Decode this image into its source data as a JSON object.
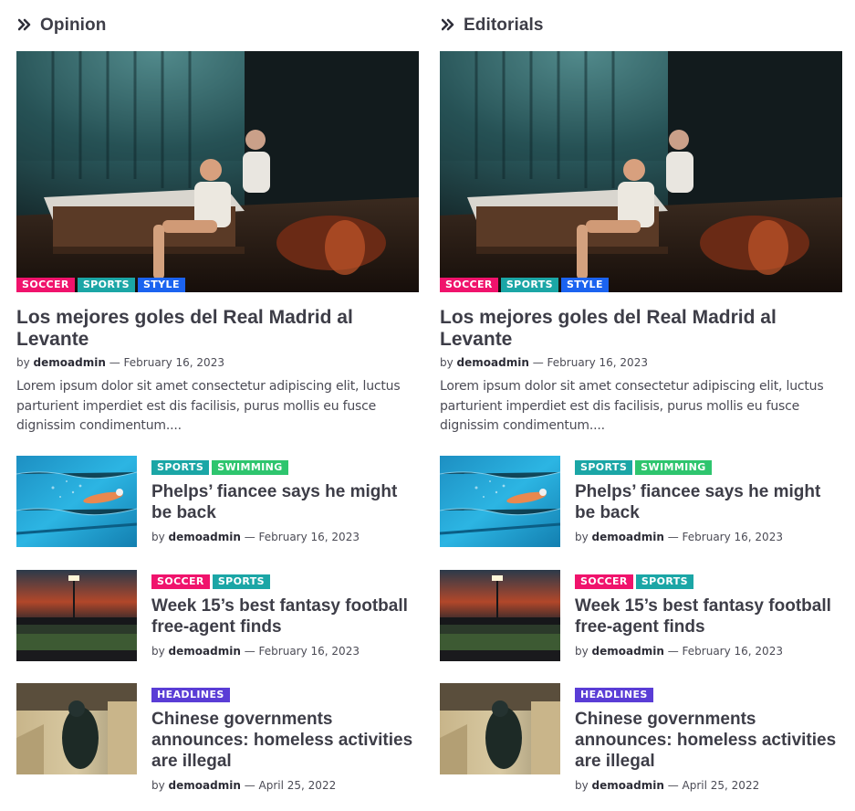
{
  "columns": [
    {
      "section_title": "Opinion",
      "featured": {
        "tags": [
          "SOCCER",
          "SPORTS",
          "STYLE"
        ],
        "title": "Los mejores goles del Real Madrid al Levante",
        "by": "by",
        "author": "demoadmin",
        "date_sep": "—",
        "date": "February 16, 2023",
        "excerpt": "Lorem ipsum dolor sit amet consectetur adipiscing elit, luctus parturient imperdiet est dis facilisis, purus mollis eu fusce dignissim condimentum...."
      },
      "items": [
        {
          "tags": [
            "SPORTS",
            "SWIMMING"
          ],
          "title": "Phelps’ fiancee says he might be back",
          "by": "by",
          "author": "demoadmin",
          "date_sep": "—",
          "date": "February 16, 2023"
        },
        {
          "tags": [
            "SOCCER",
            "SPORTS"
          ],
          "title": "Week 15’s best fantasy football free-agent finds",
          "by": "by",
          "author": "demoadmin",
          "date_sep": "—",
          "date": "February 16, 2023"
        },
        {
          "tags": [
            "HEADLINES"
          ],
          "title": "Chinese governments announces: homeless activities are illegal",
          "by": "by",
          "author": "demoadmin",
          "date_sep": "—",
          "date": "April 25, 2022"
        }
      ]
    },
    {
      "section_title": "Editorials",
      "featured": {
        "tags": [
          "SOCCER",
          "SPORTS",
          "STYLE"
        ],
        "title": "Los mejores goles del Real Madrid al Levante",
        "by": "by",
        "author": "demoadmin",
        "date_sep": "—",
        "date": "February 16, 2023",
        "excerpt": "Lorem ipsum dolor sit amet consectetur adipiscing elit, luctus parturient imperdiet est dis facilisis, purus mollis eu fusce dignissim condimentum...."
      },
      "items": [
        {
          "tags": [
            "SPORTS",
            "SWIMMING"
          ],
          "title": "Phelps’ fiancee says he might be back",
          "by": "by",
          "author": "demoadmin",
          "date_sep": "—",
          "date": "February 16, 2023"
        },
        {
          "tags": [
            "SOCCER",
            "SPORTS"
          ],
          "title": "Week 15’s best fantasy football free-agent finds",
          "by": "by",
          "author": "demoadmin",
          "date_sep": "—",
          "date": "February 16, 2023"
        },
        {
          "tags": [
            "HEADLINES"
          ],
          "title": "Chinese governments announces: homeless activities are illegal",
          "by": "by",
          "author": "demoadmin",
          "date_sep": "—",
          "date": "April 25, 2022"
        }
      ]
    }
  ],
  "icons": {
    "section": "double-chevron-right-icon"
  },
  "colors": {
    "soccer": "#f0136c",
    "sports": "#1ba6a6",
    "style": "#1b63f0",
    "swimming": "#2ec56e",
    "headlines": "#5a3dd6",
    "heading_text": "#3d3d47"
  }
}
